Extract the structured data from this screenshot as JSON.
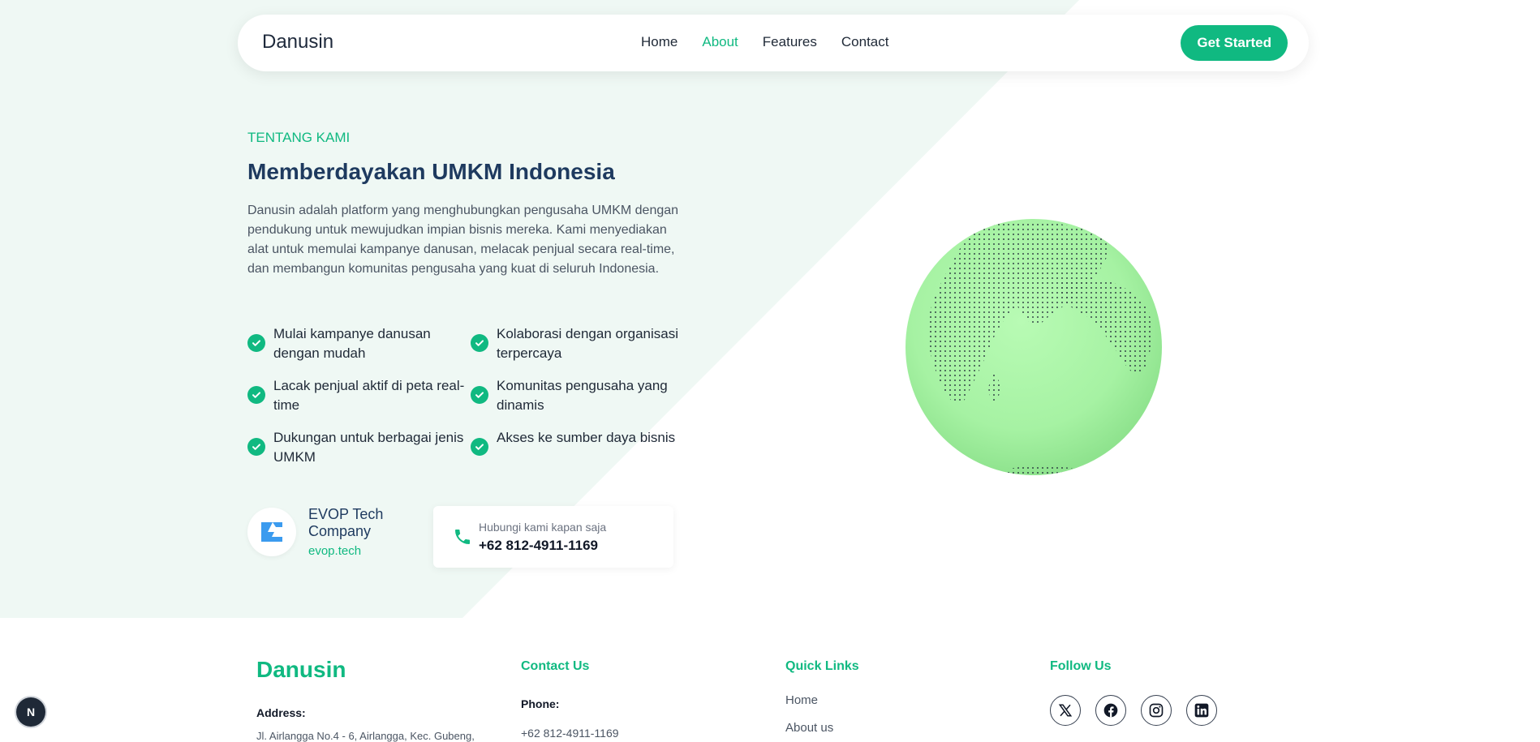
{
  "nav": {
    "brand": "Danusin",
    "items": [
      {
        "label": "Home",
        "active": false
      },
      {
        "label": "About",
        "active": true
      },
      {
        "label": "Features",
        "active": false
      },
      {
        "label": "Contact",
        "active": false
      }
    ],
    "cta": "Get Started"
  },
  "hero": {
    "eyebrow": "TENTANG KAMI",
    "title": "Memberdayakan UMKM Indonesia",
    "description": "Danusin adalah platform yang menghubungkan pengusaha UMKM dengan pendukung untuk mewujudkan impian bisnis mereka. Kami menyediakan alat untuk memulai kampanye danusan, melacak penjual secara real-time, dan membangun komunitas pengusaha yang kuat di seluruh Indonesia.",
    "features": [
      "Mulai kampanye danusan dengan mudah",
      "Kolaborasi dengan organisasi terpercaya",
      "Lacak penjual aktif di peta real-time",
      "Komunitas pengusaha yang dinamis",
      "Dukungan untuk berbagai jenis UMKM",
      "Akses ke sumber daya bisnis"
    ],
    "company": {
      "name": "EVOP Tech Company",
      "url": "evop.tech"
    },
    "contact": {
      "label": "Hubungi kami kapan saja",
      "phone": "+62 812-4911-1169"
    }
  },
  "footer": {
    "brand": "Danusin",
    "address_label": "Address:",
    "address": "Jl. Airlangga No.4 - 6, Airlangga, Kec. Gubeng,",
    "contact_heading": "Contact Us",
    "phone_label": "Phone:",
    "phone": "+62 812-4911-1169",
    "links_heading": "Quick Links",
    "links": [
      "Home",
      "About us"
    ],
    "follow_heading": "Follow Us",
    "socials": [
      "x-icon",
      "facebook-icon",
      "instagram-icon",
      "linkedin-icon"
    ]
  },
  "badge": "N",
  "colors": {
    "accent": "#10b981",
    "heading": "#1e3a5f",
    "tint": "#eff8f4",
    "globe": "#a7f3a7"
  }
}
